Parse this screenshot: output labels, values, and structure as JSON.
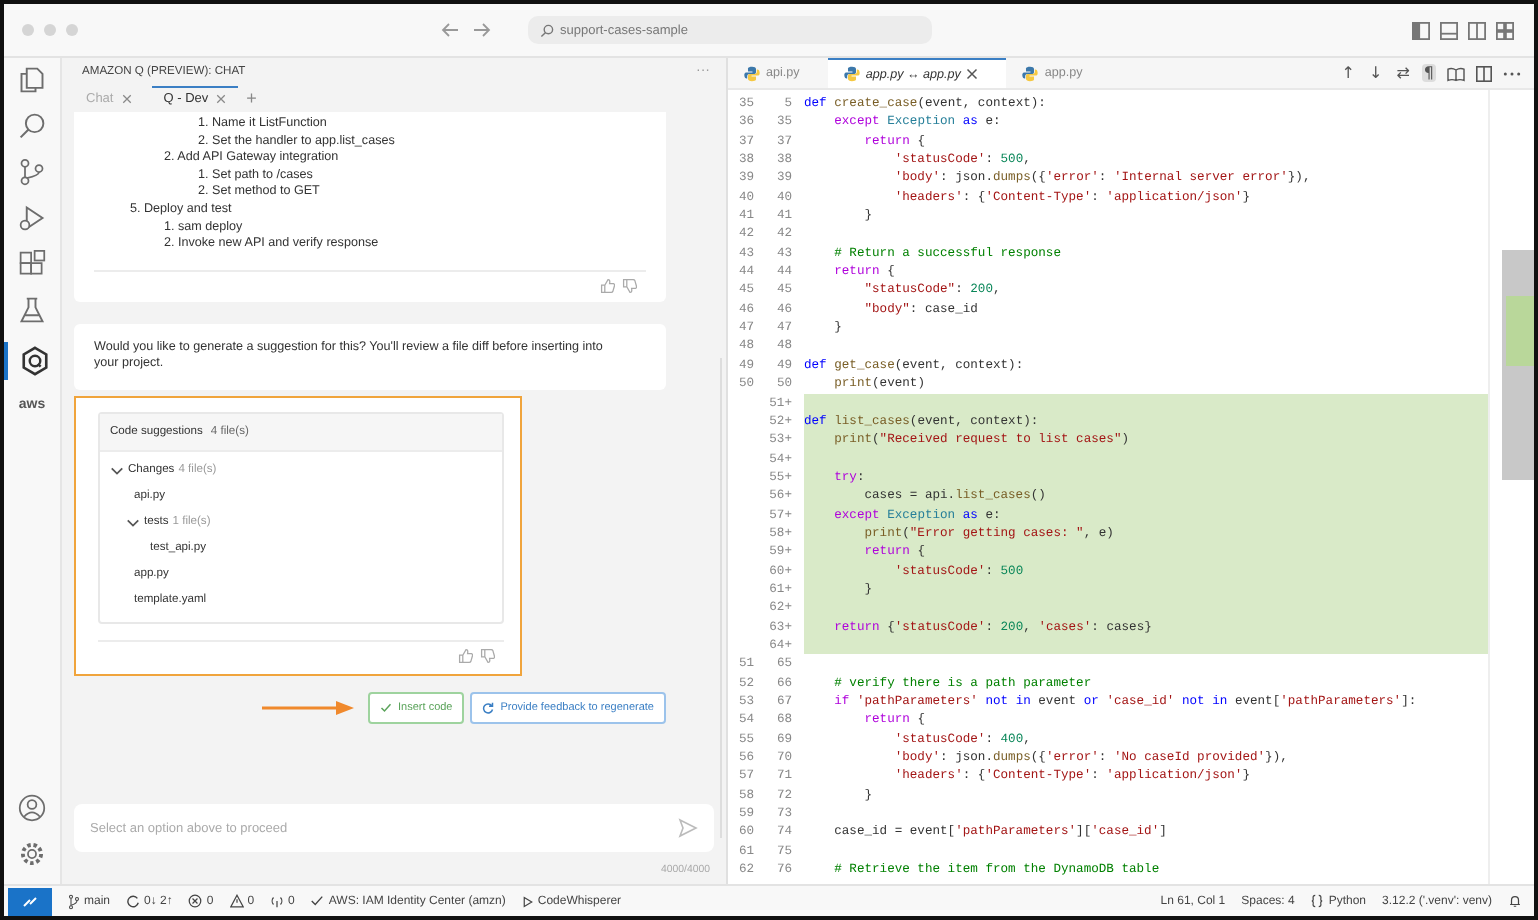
{
  "window": {
    "search": "support-cases-sample"
  },
  "chat": {
    "title": "AMAZON Q (PREVIEW): CHAT",
    "more": "···",
    "tabs": [
      {
        "label": "Chat",
        "selected": false
      },
      {
        "label": "Q - Dev",
        "selected": true
      }
    ],
    "new_tab": "+",
    "outline": [
      {
        "children": [
          {
            "children": [
              {
                "text": "1. Name it ListFunction"
              },
              {
                "text": "2. Set the handler to app.list_cases"
              }
            ]
          },
          {
            "text": "2. Add API Gateway integration",
            "children": [
              {
                "text": "1. Set path to /cases"
              },
              {
                "text": "2. Set method to GET"
              }
            ]
          }
        ]
      },
      {
        "text": "5. Deploy and test",
        "children": [
          {
            "text": "1. sam deploy"
          },
          {
            "text": "2. Invoke new API and verify response"
          }
        ]
      }
    ],
    "question": "Would you like to generate a suggestion for this? You'll review a file diff before inserting into your project.",
    "suggestions": {
      "title": "Code suggestions",
      "count": "4 file(s)",
      "highlighted": true,
      "tree": [
        {
          "label": "Changes",
          "count": "4 file(s)",
          "expanded": true,
          "children": [
            {
              "label": "api.py"
            },
            {
              "label": "tests",
              "count": "1 file(s)",
              "expanded": true,
              "children": [
                {
                  "label": "test_api.py"
                }
              ]
            },
            {
              "label": "app.py"
            },
            {
              "label": "template.yaml"
            }
          ]
        }
      ]
    },
    "actions": [
      {
        "kind": "insert",
        "label": "Insert code"
      },
      {
        "kind": "regenerate",
        "label": "Provide feedback to regenerate"
      }
    ],
    "input": {
      "placeholder": "Select an option above to proceed",
      "counter": "4000/4000"
    }
  },
  "editor": {
    "tabs": [
      {
        "label": "api.py",
        "selected": false,
        "preview": false
      },
      {
        "label": "app.py ↔ app.py",
        "selected": true,
        "preview": true
      },
      {
        "label": "app.py",
        "selected": false,
        "preview": false
      }
    ],
    "toolbar": [
      {
        "glyph": "↑",
        "selected": false
      },
      {
        "glyph": "↓",
        "selected": false
      },
      {
        "glyph": "⇄",
        "selected": false
      },
      {
        "glyph": "¶",
        "selected": true
      }
    ],
    "lines": [
      {
        "old": "35",
        "new": "5",
        "added": false,
        "code": [
          {
            "kind": "keyword",
            "text": "def "
          },
          {
            "kind": "function",
            "text": "create_case"
          },
          {
            "kind": "plain",
            "text": "(event, context):"
          }
        ]
      },
      {
        "old": "36",
        "new": "35",
        "added": false,
        "code": [
          {
            "kind": "control",
            "text": "    except "
          },
          {
            "kind": "class",
            "text": "Exception "
          },
          {
            "kind": "keyword",
            "text": "as "
          },
          {
            "kind": "plain",
            "text": "e:"
          }
        ]
      },
      {
        "old": "37",
        "new": "37",
        "added": false,
        "code": [
          {
            "kind": "control",
            "text": "        return "
          },
          {
            "kind": "plain",
            "text": "{"
          }
        ]
      },
      {
        "old": "38",
        "new": "38",
        "added": false,
        "code": [
          {
            "kind": "string",
            "text": "            'statusCode'"
          },
          {
            "kind": "plain",
            "text": ": "
          },
          {
            "kind": "number",
            "text": "500"
          },
          {
            "kind": "plain",
            "text": ","
          }
        ]
      },
      {
        "old": "39",
        "new": "39",
        "added": false,
        "code": [
          {
            "kind": "string",
            "text": "            'body'"
          },
          {
            "kind": "plain",
            "text": ": json."
          },
          {
            "kind": "function",
            "text": "dumps"
          },
          {
            "kind": "plain",
            "text": "({"
          },
          {
            "kind": "string",
            "text": "'error'"
          },
          {
            "kind": "plain",
            "text": ": "
          },
          {
            "kind": "string",
            "text": "'Internal server error'"
          },
          {
            "kind": "plain",
            "text": "}),"
          }
        ]
      },
      {
        "old": "40",
        "new": "40",
        "added": false,
        "code": [
          {
            "kind": "string",
            "text": "            'headers'"
          },
          {
            "kind": "plain",
            "text": ": {"
          },
          {
            "kind": "string",
            "text": "'Content-Type'"
          },
          {
            "kind": "plain",
            "text": ": "
          },
          {
            "kind": "string",
            "text": "'application/json'"
          },
          {
            "kind": "plain",
            "text": "}"
          }
        ]
      },
      {
        "old": "41",
        "new": "41",
        "added": false,
        "code": [
          {
            "kind": "plain",
            "text": "        }"
          }
        ]
      },
      {
        "old": "42",
        "new": "42",
        "added": false
      },
      {
        "old": "43",
        "new": "43",
        "added": false,
        "code": [
          {
            "kind": "comment",
            "text": "    # Return a successful response"
          }
        ]
      },
      {
        "old": "44",
        "new": "44",
        "added": false,
        "code": [
          {
            "kind": "control",
            "text": "    return "
          },
          {
            "kind": "plain",
            "text": "{"
          }
        ]
      },
      {
        "old": "45",
        "new": "45",
        "added": false,
        "code": [
          {
            "kind": "string",
            "text": "        \"statusCode\""
          },
          {
            "kind": "plain",
            "text": ": "
          },
          {
            "kind": "number",
            "text": "200"
          },
          {
            "kind": "plain",
            "text": ","
          }
        ]
      },
      {
        "old": "46",
        "new": "46",
        "added": false,
        "code": [
          {
            "kind": "string",
            "text": "        \"body\""
          },
          {
            "kind": "plain",
            "text": ": case_id"
          }
        ]
      },
      {
        "old": "47",
        "new": "47",
        "added": false,
        "code": [
          {
            "kind": "plain",
            "text": "    }"
          }
        ]
      },
      {
        "old": "48",
        "new": "48",
        "added": false
      },
      {
        "old": "49",
        "new": "49",
        "added": false,
        "code": [
          {
            "kind": "keyword",
            "text": "def "
          },
          {
            "kind": "function",
            "text": "get_case"
          },
          {
            "kind": "plain",
            "text": "(event, context):"
          }
        ]
      },
      {
        "old": "50",
        "new": "50",
        "added": false,
        "code": [
          {
            "kind": "function",
            "text": "    print"
          },
          {
            "kind": "plain",
            "text": "(event)"
          }
        ]
      },
      {
        "new": "51+",
        "added": true
      },
      {
        "new": "52+",
        "added": true,
        "code": [
          {
            "kind": "keyword",
            "text": "def "
          },
          {
            "kind": "function",
            "text": "list_cases"
          },
          {
            "kind": "plain",
            "text": "(event, context):"
          }
        ]
      },
      {
        "new": "53+",
        "added": true,
        "code": [
          {
            "kind": "function",
            "text": "    print"
          },
          {
            "kind": "plain",
            "text": "("
          },
          {
            "kind": "string",
            "text": "\"Received request to list cases\""
          },
          {
            "kind": "plain",
            "text": ")"
          }
        ]
      },
      {
        "new": "54+",
        "added": true
      },
      {
        "new": "55+",
        "added": true,
        "code": [
          {
            "kind": "control",
            "text": "    try"
          },
          {
            "kind": "plain",
            "text": ":"
          }
        ]
      },
      {
        "new": "56+",
        "added": true,
        "code": [
          {
            "kind": "plain",
            "text": "        cases = api."
          },
          {
            "kind": "function",
            "text": "list_cases"
          },
          {
            "kind": "plain",
            "text": "()"
          }
        ]
      },
      {
        "new": "57+",
        "added": true,
        "code": [
          {
            "kind": "control",
            "text": "    except "
          },
          {
            "kind": "class",
            "text": "Exception "
          },
          {
            "kind": "keyword",
            "text": "as "
          },
          {
            "kind": "plain",
            "text": "e:"
          }
        ]
      },
      {
        "new": "58+",
        "added": true,
        "code": [
          {
            "kind": "function",
            "text": "        print"
          },
          {
            "kind": "plain",
            "text": "("
          },
          {
            "kind": "string",
            "text": "\"Error getting cases: \""
          },
          {
            "kind": "plain",
            "text": ", e)"
          }
        ]
      },
      {
        "new": "59+",
        "added": true,
        "code": [
          {
            "kind": "control",
            "text": "        return "
          },
          {
            "kind": "plain",
            "text": "{"
          }
        ]
      },
      {
        "new": "60+",
        "added": true,
        "code": [
          {
            "kind": "string",
            "text": "            'statusCode'"
          },
          {
            "kind": "plain",
            "text": ": "
          },
          {
            "kind": "number",
            "text": "500"
          }
        ]
      },
      {
        "new": "61+",
        "added": true,
        "code": [
          {
            "kind": "plain",
            "text": "        }"
          }
        ]
      },
      {
        "new": "62+",
        "added": true
      },
      {
        "new": "63+",
        "added": true,
        "code": [
          {
            "kind": "control",
            "text": "    return "
          },
          {
            "kind": "plain",
            "text": "{"
          },
          {
            "kind": "string",
            "text": "'statusCode'"
          },
          {
            "kind": "plain",
            "text": ": "
          },
          {
            "kind": "number",
            "text": "200"
          },
          {
            "kind": "plain",
            "text": ", "
          },
          {
            "kind": "string",
            "text": "'cases'"
          },
          {
            "kind": "plain",
            "text": ": cases}"
          }
        ]
      },
      {
        "new": "64+",
        "added": true
      },
      {
        "old": "51",
        "new": "65",
        "added": false
      },
      {
        "old": "52",
        "new": "66",
        "added": false,
        "code": [
          {
            "kind": "comment",
            "text": "    # verify there is a path parameter"
          }
        ]
      },
      {
        "old": "53",
        "new": "67",
        "added": false,
        "code": [
          {
            "kind": "control",
            "text": "    if "
          },
          {
            "kind": "string",
            "text": "'pathParameters'"
          },
          {
            "kind": "keyword",
            "text": " not in "
          },
          {
            "kind": "plain",
            "text": "event "
          },
          {
            "kind": "keyword",
            "text": "or "
          },
          {
            "kind": "string",
            "text": "'case_id'"
          },
          {
            "kind": "keyword",
            "text": " not in "
          },
          {
            "kind": "plain",
            "text": "event["
          },
          {
            "kind": "string",
            "text": "'pathParameters'"
          },
          {
            "kind": "plain",
            "text": "]:"
          }
        ]
      },
      {
        "old": "54",
        "new": "68",
        "added": false,
        "code": [
          {
            "kind": "control",
            "text": "        return "
          },
          {
            "kind": "plain",
            "text": "{"
          }
        ]
      },
      {
        "old": "55",
        "new": "69",
        "added": false,
        "code": [
          {
            "kind": "string",
            "text": "            'statusCode'"
          },
          {
            "kind": "plain",
            "text": ": "
          },
          {
            "kind": "number",
            "text": "400"
          },
          {
            "kind": "plain",
            "text": ","
          }
        ]
      },
      {
        "old": "56",
        "new": "70",
        "added": false,
        "code": [
          {
            "kind": "string",
            "text": "            'body'"
          },
          {
            "kind": "plain",
            "text": ": json."
          },
          {
            "kind": "function",
            "text": "dumps"
          },
          {
            "kind": "plain",
            "text": "({"
          },
          {
            "kind": "string",
            "text": "'error'"
          },
          {
            "kind": "plain",
            "text": ": "
          },
          {
            "kind": "string",
            "text": "'No caseId provided'"
          },
          {
            "kind": "plain",
            "text": "}),"
          }
        ]
      },
      {
        "old": "57",
        "new": "71",
        "added": false,
        "code": [
          {
            "kind": "string",
            "text": "            'headers'"
          },
          {
            "kind": "plain",
            "text": ": {"
          },
          {
            "kind": "string",
            "text": "'Content-Type'"
          },
          {
            "kind": "plain",
            "text": ": "
          },
          {
            "kind": "string",
            "text": "'application/json'"
          },
          {
            "kind": "plain",
            "text": "}"
          }
        ]
      },
      {
        "old": "58",
        "new": "72",
        "added": false,
        "code": [
          {
            "kind": "plain",
            "text": "        }"
          }
        ]
      },
      {
        "old": "59",
        "new": "73",
        "added": false
      },
      {
        "old": "60",
        "new": "74",
        "added": false,
        "code": [
          {
            "kind": "plain",
            "text": "    case_id = event["
          },
          {
            "kind": "string",
            "text": "'pathParameters'"
          },
          {
            "kind": "plain",
            "text": "]["
          },
          {
            "kind": "string",
            "text": "'case_id'"
          },
          {
            "kind": "plain",
            "text": "]"
          }
        ]
      },
      {
        "old": "61",
        "new": "75",
        "added": false
      },
      {
        "old": "62",
        "new": "76",
        "added": false,
        "code": [
          {
            "kind": "comment",
            "text": "    # Retrieve the item from the DynamoDB table"
          }
        ]
      }
    ]
  },
  "activity": {
    "items": [
      {
        "kind": "files",
        "selected": false
      },
      {
        "kind": "search",
        "selected": false
      },
      {
        "kind": "git",
        "selected": false
      },
      {
        "kind": "debug",
        "selected": false
      },
      {
        "kind": "extensions",
        "selected": false
      },
      {
        "kind": "flask",
        "selected": false
      },
      {
        "kind": "q",
        "selected": true
      },
      {
        "kind": "aws",
        "selected": false,
        "label": "aws"
      }
    ]
  },
  "status_bar": {
    "left": [
      {
        "kind": "branch",
        "text": "main"
      },
      {
        "kind": "sync",
        "text": "0↓ 2↑"
      },
      {
        "kind": "errors",
        "text": "0"
      },
      {
        "kind": "warnings",
        "text": "0"
      },
      {
        "kind": "ports",
        "text": "0"
      },
      {
        "kind": "connection",
        "text": "AWS: IAM Identity Center (amzn)"
      },
      {
        "kind": "extension",
        "text": "CodeWhisperer"
      }
    ],
    "right": [
      {
        "kind": "cursor",
        "text": "Ln 61, Col 1"
      },
      {
        "kind": "indent",
        "text": "Spaces: 4"
      },
      {
        "kind": "language",
        "text": "Python"
      },
      {
        "kind": "interpreter",
        "text": "3.12.2 ('.venv': venv)"
      }
    ]
  }
}
